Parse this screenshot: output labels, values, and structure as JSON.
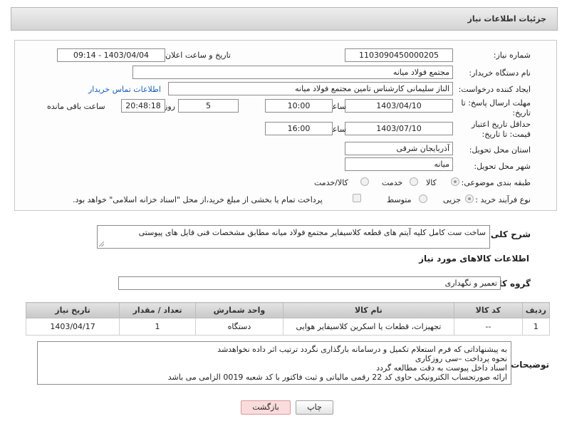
{
  "header": {
    "title": "جزئیات اطلاعات نیاز"
  },
  "form": {
    "need_number_label": "شماره نیاز:",
    "need_number": "1103090450000205",
    "announce_label": "تاریخ و ساعت اعلان عمومی:",
    "announce_value": "1403/04/04 - 09:14",
    "buyer_org_label": "نام دستگاه خریدار:",
    "buyer_org": "مجتمع فولاد میانه",
    "creator_label": "ایجاد کننده درخواست:",
    "creator": "الناز سلیمانی کارشناس تامین مجتمع فولاد میانه",
    "contact_link": "اطلاعات تماس خریدار",
    "deadline_label": "مهلت ارسال پاسخ: تا تاریخ:",
    "deadline_date": "1403/04/10",
    "time_label": "ساعت",
    "deadline_time": "10:00",
    "days_value": "5",
    "days_label": "روز و",
    "remaining_time": "20:48:18",
    "remaining_label": "ساعت باقی مانده",
    "validity_label": "حداقل تاریخ اعتبار قیمت: تا تاریخ:",
    "validity_date": "1403/07/10",
    "validity_time_label": "ساعت",
    "validity_time": "16:00",
    "province_label": "استان محل تحویل:",
    "province": "آذربایجان شرقی",
    "city_label": "شهر محل تحویل:",
    "city": "میانه",
    "category_label": "طبقه بندی موضوعی:",
    "category_goods": "کالا",
    "category_service": "خدمت",
    "category_both": "کالا/خدمت",
    "process_label": "نوع فرآیند خرید :",
    "process_minor": "جزیی",
    "process_medium": "متوسط",
    "payment_note": "پرداخت تمام یا بخشی از مبلغ خرید،از محل \"اسناد خزانه اسلامی\" خواهد بود."
  },
  "description": {
    "label": "شرح کلی نیاز:",
    "text": "ساخت ست کامل کلیه آیتم های قطعه کلاسیفایر مجتمع فولاد میانه مطابق مشخصات فنی فایل های پیوستی"
  },
  "goods_info": {
    "title": "اطلاعات کالاهای مورد نیاز",
    "group_label": "گروه کالا:",
    "group_value": "تعمیر و نگهداری"
  },
  "table": {
    "headers": [
      "ردیف",
      "کد کالا",
      "نام کالا",
      "واحد شمارش",
      "تعداد / مقدار",
      "تاریخ نیاز"
    ],
    "rows": [
      [
        "1",
        "--",
        "تجهیزات، قطعات یا اسکرین کلاسیفایر هوایی",
        "دستگاه",
        "1",
        "1403/04/17"
      ]
    ]
  },
  "buyer_notes": {
    "label": "توضیحات خریدار:",
    "lines": [
      "به پیشنهاداتی که فرم استعلام تکمیل و درسامانه بارگذاری نگردد ترتیب اثر داده نخواهدشد",
      "نحوه پرداخت –سی روزکاری",
      "اسناد داخل پیوست به دقت مطالعه گردد",
      "ارائه صورتحساب الکترونیکی حاوی کد 22 رقمی مالیاتی و ثبت فاکتور با کد شعبه 0019 الزامی می باشد"
    ]
  },
  "buttons": {
    "print": "چاپ",
    "back": "بازگشت"
  }
}
